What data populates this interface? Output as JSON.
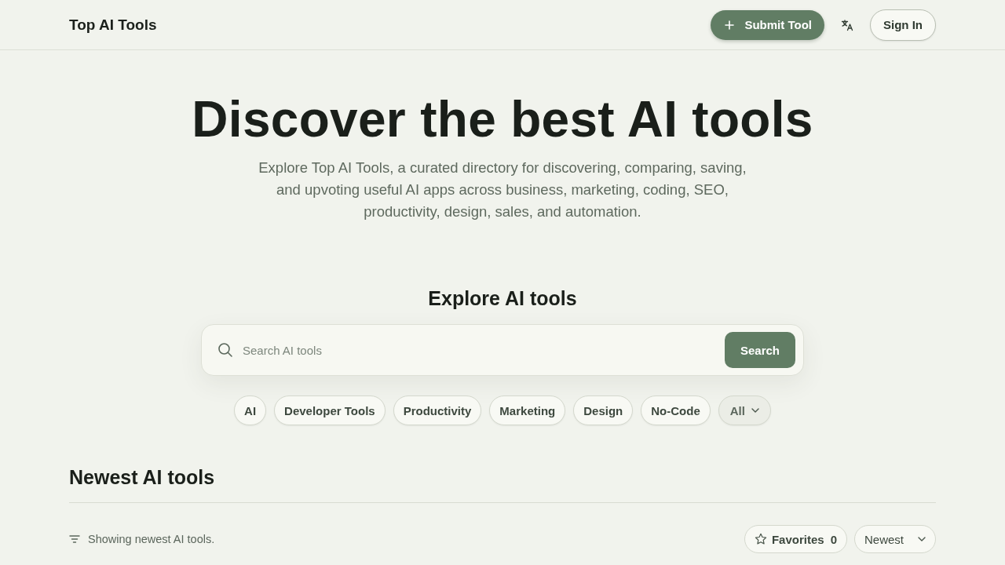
{
  "header": {
    "logo": "Top AI Tools",
    "submit_button": {
      "label": "Submit Tool"
    },
    "sign_in_button": {
      "label": "Sign In"
    }
  },
  "hero": {
    "title": "Discover the best AI tools",
    "description": "Explore Top AI Tools, a curated directory for discovering, comparing, saving, and upvoting useful AI apps across business, marketing, coding, SEO, productivity, design, sales, and automation."
  },
  "explore": {
    "heading": "Explore AI tools",
    "search": {
      "placeholder": "Search AI tools",
      "button": "Search"
    },
    "categories": [
      {
        "label": "AI",
        "kind": "chip"
      },
      {
        "label": "Developer Tools",
        "kind": "chip"
      },
      {
        "label": "Productivity",
        "kind": "chip"
      },
      {
        "label": "Marketing",
        "kind": "chip"
      },
      {
        "label": "Design",
        "kind": "chip"
      },
      {
        "label": "No-Code",
        "kind": "chip"
      },
      {
        "label": "All",
        "kind": "dropdown"
      }
    ]
  },
  "newest": {
    "heading": "Newest AI tools",
    "status": "Showing newest AI tools.",
    "favorites": {
      "label": "Favorites",
      "count": "0"
    },
    "sort": {
      "label": "Newest"
    }
  }
}
